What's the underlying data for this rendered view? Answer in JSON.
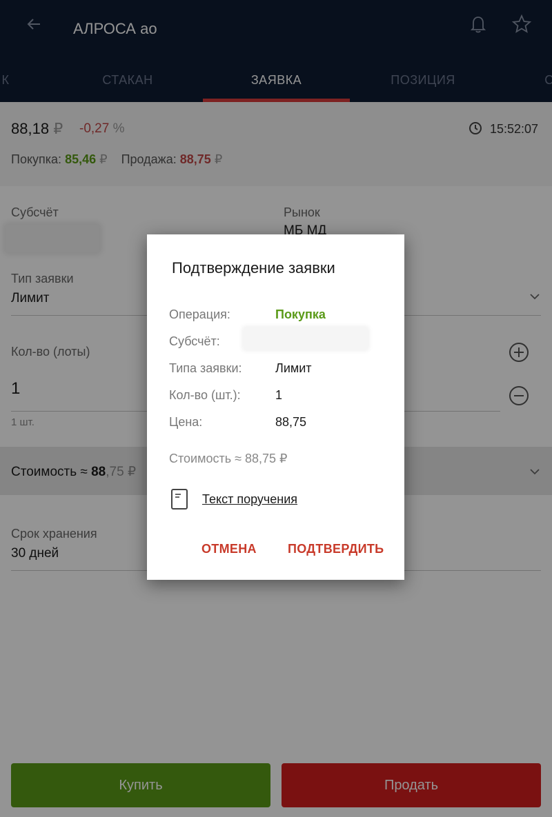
{
  "header": {
    "title": "АЛРОСА ао",
    "tabs": [
      {
        "label": "К"
      },
      {
        "label": "СТАКАН"
      },
      {
        "label": "ЗАЯВКА"
      },
      {
        "label": "ПОЗИЦИЯ"
      },
      {
        "label": "С"
      }
    ],
    "active_tab": "ЗАЯВКА"
  },
  "quote": {
    "price": "88,18",
    "price_currency": "₽",
    "change": "-0,27",
    "change_unit": "%",
    "time": "15:52:07",
    "buy_label": "Покупка:",
    "buy_value": "85,46",
    "sell_label": "Продажа:",
    "sell_value": "88,75",
    "currency": "₽"
  },
  "form": {
    "subaccount_label": "Субсчёт",
    "market_label": "Рынок",
    "market_value": "МБ МД",
    "order_type_label": "Тип заявки",
    "order_type_value": "Лимит",
    "qty_label": "Кол-во (лоты)",
    "qty_value": "1",
    "qty_hint": "1 шт.",
    "cost_label": "Стоимость ≈",
    "cost_value": "88",
    "cost_frac": ",75 ₽",
    "storage_label": "Срок хранения",
    "storage_value": "30 дней"
  },
  "actions": {
    "buy": "Купить",
    "sell": "Продать"
  },
  "dialog": {
    "title": "Подтверждение заявки",
    "rows": [
      {
        "label": "Операция:",
        "value": "Покупка"
      },
      {
        "label": "Субсчёт:",
        "value": ""
      },
      {
        "label": "Типа заявки:",
        "value": "Лимит"
      },
      {
        "label": "Кол-во (шт.):",
        "value": "1"
      },
      {
        "label": "Цена:",
        "value": "88,75"
      }
    ],
    "cost": "Стоимость ≈ 88,75 ₽",
    "order_text_link": "Текст поручения",
    "cancel": "ОТМЕНА",
    "confirm": "ПОДТВЕРДИТЬ"
  },
  "colors": {
    "header_bg": "#0f1d33",
    "accent_red": "#d73c3c",
    "buy_green": "#5a9a18",
    "sell_red": "#d31e1e"
  },
  "icons": [
    "back-arrow-icon",
    "bell-icon",
    "star-icon",
    "clock-icon",
    "chevron-down-icon",
    "plus-icon",
    "minus-icon",
    "document-icon"
  ]
}
